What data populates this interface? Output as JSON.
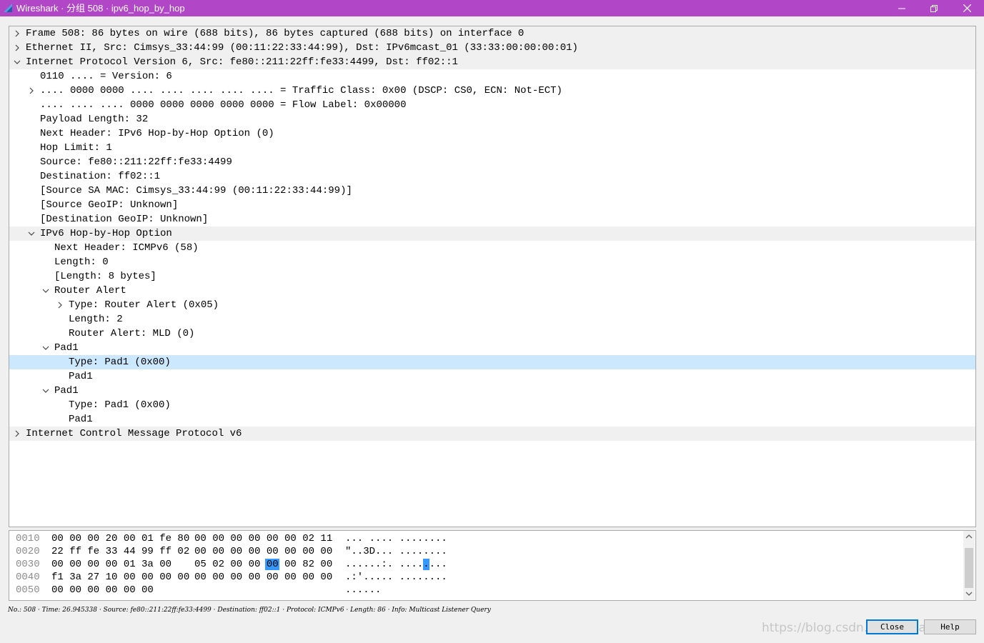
{
  "window": {
    "title": "Wireshark · 分组 508 · ipv6_hop_by_hop"
  },
  "tree": [
    {
      "text": "Frame 508: 86 bytes on wire (688 bits), 86 bytes captured (688 bits) on interface 0",
      "level": 0,
      "state": "collapsed",
      "header": true
    },
    {
      "text": "Ethernet II, Src: Cimsys_33:44:99 (00:11:22:33:44:99), Dst: IPv6mcast_01 (33:33:00:00:00:01)",
      "level": 0,
      "state": "collapsed",
      "header": true
    },
    {
      "text": "Internet Protocol Version 6, Src: fe80::211:22ff:fe33:4499, Dst: ff02::1",
      "level": 0,
      "state": "expanded",
      "header": true
    },
    {
      "text": "0110 .... = Version: 6",
      "level": 1,
      "state": "leaf"
    },
    {
      "text": ".... 0000 0000 .... .... .... .... .... = Traffic Class: 0x00 (DSCP: CS0, ECN: Not-ECT)",
      "level": 1,
      "state": "collapsed"
    },
    {
      "text": ".... .... .... 0000 0000 0000 0000 0000 = Flow Label: 0x00000",
      "level": 1,
      "state": "leaf"
    },
    {
      "text": "Payload Length: 32",
      "level": 1,
      "state": "leaf"
    },
    {
      "text": "Next Header: IPv6 Hop-by-Hop Option (0)",
      "level": 1,
      "state": "leaf"
    },
    {
      "text": "Hop Limit: 1",
      "level": 1,
      "state": "leaf"
    },
    {
      "text": "Source: fe80::211:22ff:fe33:4499",
      "level": 1,
      "state": "leaf"
    },
    {
      "text": "Destination: ff02::1",
      "level": 1,
      "state": "leaf"
    },
    {
      "text": "[Source SA MAC: Cimsys_33:44:99 (00:11:22:33:44:99)]",
      "level": 1,
      "state": "leaf"
    },
    {
      "text": "[Source GeoIP: Unknown]",
      "level": 1,
      "state": "leaf"
    },
    {
      "text": "[Destination GeoIP: Unknown]",
      "level": 1,
      "state": "leaf"
    },
    {
      "text": "IPv6 Hop-by-Hop Option",
      "level": 1,
      "state": "expanded",
      "header": true
    },
    {
      "text": "Next Header: ICMPv6 (58)",
      "level": 2,
      "state": "leaf"
    },
    {
      "text": "Length: 0",
      "level": 2,
      "state": "leaf"
    },
    {
      "text": "[Length: 8 bytes]",
      "level": 2,
      "state": "leaf"
    },
    {
      "text": "Router Alert",
      "level": 2,
      "state": "expanded"
    },
    {
      "text": "Type: Router Alert (0x05)",
      "level": 3,
      "state": "collapsed"
    },
    {
      "text": "Length: 2",
      "level": 3,
      "state": "leaf"
    },
    {
      "text": "Router Alert: MLD (0)",
      "level": 3,
      "state": "leaf"
    },
    {
      "text": "Pad1",
      "level": 2,
      "state": "expanded"
    },
    {
      "text": "Type: Pad1 (0x00)",
      "level": 3,
      "state": "leaf",
      "selected": true
    },
    {
      "text": "Pad1",
      "level": 3,
      "state": "leaf"
    },
    {
      "text": "Pad1",
      "level": 2,
      "state": "expanded"
    },
    {
      "text": "Type: Pad1 (0x00)",
      "level": 3,
      "state": "leaf"
    },
    {
      "text": "Pad1",
      "level": 3,
      "state": "leaf"
    },
    {
      "text": "Internet Control Message Protocol v6",
      "level": 0,
      "state": "collapsed",
      "header": true
    }
  ],
  "hex": [
    {
      "offset": "0010",
      "bytes1": "00 00 00 20 00 01 fe 80",
      "bytes2": "00 00 00 00 00 00 02 11",
      "ascii": "... .... ........"
    },
    {
      "offset": "0020",
      "bytes1": "22 ff fe 33 44 99 ff 02",
      "bytes2": "00 00 00 00 00 00 00 00",
      "ascii": "\"..3D... ........"
    },
    {
      "offset": "0030",
      "bytes1": "00 00 00 00 01 3a 00",
      "bytes2": "05 02 00 00 00 00 82 00",
      "ascii": "......:. ........",
      "selected_byte": 12
    },
    {
      "offset": "0040",
      "bytes1": "f1 3a 27 10 00 00 00 00",
      "bytes2": "00 00 00 00 00 00 00 00",
      "ascii": ".:'..... ........"
    },
    {
      "offset": "0050",
      "bytes1": "00 00 00 00 00 00",
      "bytes2": "",
      "ascii": "......"
    }
  ],
  "status": "No.: 508 · Time: 26.945338 · Source: fe80::211:22ff:fe33:4499 · Destination: ff02::1 · Protocol: ICMPv6 · Length: 86 · Info: Multicast Listener Query",
  "buttons": {
    "close": "Close",
    "help": "Help"
  },
  "watermark": "https://blog.csdn.net/fuyuande",
  "colors": {
    "titlebar": "#b147c6",
    "selection": "#cce8ff",
    "hex_selection": "#3399ff",
    "header_row": "#f0f0f0"
  }
}
